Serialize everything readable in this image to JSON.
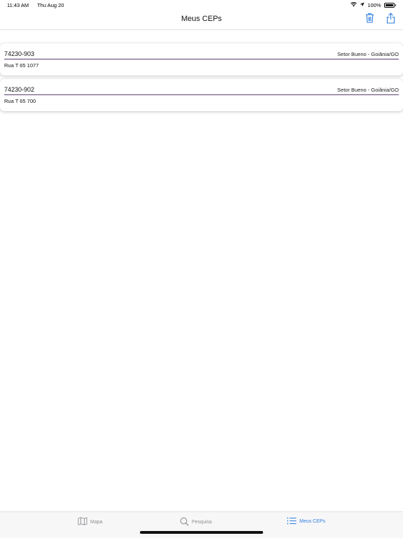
{
  "status_bar": {
    "time": "11:43 AM",
    "date": "Thu Aug 20",
    "battery": "100%",
    "battery_level": 1.0
  },
  "nav": {
    "title": "Meus CEPs",
    "trash_icon": "trash-icon",
    "share_icon": "share-icon"
  },
  "ceps": [
    {
      "cep": "74230-903",
      "region": "Setor Bueno - Goiânia/GO",
      "street": "Rua T 65 1077"
    },
    {
      "cep": "74230-902",
      "region": "Setor Bueno - Goiânia/GO",
      "street": "Rua T 65 700"
    }
  ],
  "tabs": [
    {
      "label": "Mapa",
      "icon": "map-icon",
      "active": false
    },
    {
      "label": "Pesquisa",
      "icon": "search-icon",
      "active": false
    },
    {
      "label": "Meus CEPs",
      "icon": "list-icon",
      "active": true
    }
  ],
  "colors": {
    "accent": "#2f7ee0",
    "divider": "#5a3f73",
    "inactive_tab": "#8e8e93"
  }
}
